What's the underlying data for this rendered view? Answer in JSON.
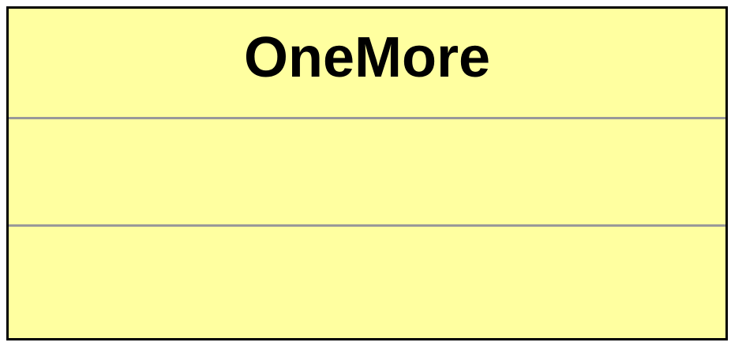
{
  "uml_class": {
    "name": "OneMore",
    "attributes": [],
    "operations": []
  },
  "colors": {
    "fill": "#ffffa0",
    "border": "#000000",
    "divider": "#999999"
  }
}
